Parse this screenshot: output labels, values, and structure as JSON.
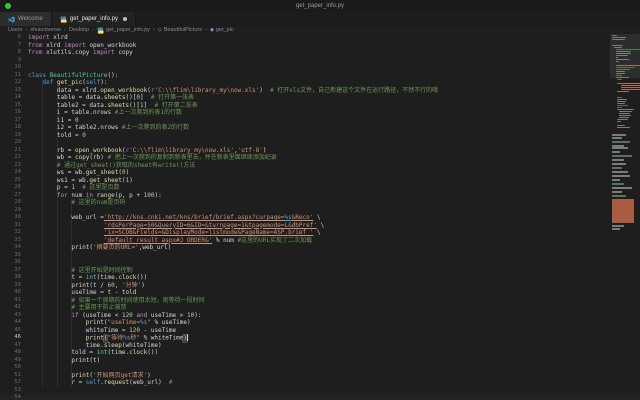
{
  "window": {
    "title": "get_paper_info.py"
  },
  "tabs": [
    {
      "label": "Welcome",
      "icon": "vscode-logo-icon",
      "active": false,
      "modified": false
    },
    {
      "label": "get_paper_info.py",
      "icon": "python-file-icon",
      "active": true,
      "modified": true
    }
  ],
  "breadcrumb": {
    "separator": "›",
    "segments": [
      {
        "label": "Users"
      },
      {
        "label": "shuiuniverse"
      },
      {
        "label": "Desktop"
      },
      {
        "label": "get_paper_info.py",
        "icon": "python-file-icon"
      },
      {
        "label": "BeautifulPicture",
        "icon": "class-symbol-icon"
      },
      {
        "label": "get_pic",
        "icon": "method-symbol-icon"
      }
    ]
  },
  "theme": {
    "traffic_light_green": "#2bc840",
    "syntax": {
      "kw": "#c586c0",
      "kb": "#569cd6",
      "cls": "#4ec9b0",
      "fn": "#dcdcaa",
      "str": "#ce9178",
      "com": "#6a9955",
      "num": "#b5cea8",
      "txt": "#d4d4d4"
    }
  },
  "editor": {
    "first_line": 6,
    "active_line": 46,
    "lines": [
      {
        "n": 6,
        "t": [
          [
            "kw",
            "import"
          ],
          [
            "txt",
            " xlrd"
          ]
        ]
      },
      {
        "n": 7,
        "t": [
          [
            "kw",
            "from"
          ],
          [
            "txt",
            " xlrd "
          ],
          [
            "kw",
            "import"
          ],
          [
            "txt",
            " open_workbook"
          ]
        ]
      },
      {
        "n": 8,
        "t": [
          [
            "kw",
            "from"
          ],
          [
            "txt",
            " xlutils.copy "
          ],
          [
            "kw",
            "import"
          ],
          [
            "txt",
            " copy"
          ]
        ]
      },
      {
        "n": 9,
        "t": []
      },
      {
        "n": 10,
        "t": []
      },
      {
        "n": 11,
        "t": [
          [
            "kb",
            "class"
          ],
          [
            "txt",
            " "
          ],
          [
            "cls",
            "BeautifulPicture"
          ],
          [
            "txt",
            "():"
          ]
        ]
      },
      {
        "n": 12,
        "t": [
          [
            "txt",
            "    "
          ],
          [
            "kb",
            "def"
          ],
          [
            "txt",
            " "
          ],
          [
            "fn",
            "get_pic"
          ],
          [
            "txt",
            "("
          ],
          [
            "kb",
            "self"
          ],
          [
            "txt",
            "):"
          ]
        ]
      },
      {
        "n": 13,
        "t": [
          [
            "txt",
            "        data = xlrd."
          ],
          [
            "fn",
            "open_workbook"
          ],
          [
            "txt",
            "("
          ],
          [
            "kb",
            "r"
          ],
          [
            "str",
            "'C:\\\\flim\\library_my\\now.xls'"
          ],
          [
            "txt",
            ")  "
          ],
          [
            "com",
            "# 打开xls文件，自己新建这个文件在运行路径，不然不行的哦"
          ]
        ]
      },
      {
        "n": 14,
        "t": [
          [
            "txt",
            "        table = data."
          ],
          [
            "fn",
            "sheets"
          ],
          [
            "txt",
            "()["
          ],
          [
            "num",
            "0"
          ],
          [
            "txt",
            "]  "
          ],
          [
            "com",
            "# 打开第一张表"
          ]
        ]
      },
      {
        "n": 15,
        "t": [
          [
            "txt",
            "        table2 = data."
          ],
          [
            "fn",
            "sheets"
          ],
          [
            "txt",
            "()["
          ],
          [
            "num",
            "1"
          ],
          [
            "txt",
            "]  "
          ],
          [
            "com",
            "# 打开第二张表"
          ]
        ]
      },
      {
        "n": 16,
        "t": [
          [
            "txt",
            "        i = table.nrows "
          ],
          [
            "com",
            "#上一次爬到的表1的行数"
          ]
        ]
      },
      {
        "n": 17,
        "t": [
          [
            "txt",
            "        i1 = "
          ],
          [
            "num",
            "0"
          ]
        ]
      },
      {
        "n": 18,
        "t": [
          [
            "txt",
            "        i2 = table2.nrows "
          ],
          [
            "com",
            "#上一次爬到的表2的行数"
          ]
        ]
      },
      {
        "n": 19,
        "t": [
          [
            "txt",
            "        told = "
          ],
          [
            "num",
            "0"
          ]
        ]
      },
      {
        "n": 20,
        "t": []
      },
      {
        "n": 21,
        "t": [
          [
            "txt",
            "        rb = "
          ],
          [
            "fn",
            "open_workbook"
          ],
          [
            "txt",
            "("
          ],
          [
            "kb",
            "r"
          ],
          [
            "str",
            "'C:\\\\flim\\library_my\\now.xls'"
          ],
          [
            "txt",
            ","
          ],
          [
            "str",
            "'utf-8'"
          ],
          [
            "txt",
            ")"
          ]
        ]
      },
      {
        "n": 22,
        "t": [
          [
            "txt",
            "        wb = "
          ],
          [
            "fn",
            "copy"
          ],
          [
            "txt",
            "(rb) "
          ],
          [
            "com",
            "# 把上一次爬到的复制到新表里去，并在新表里面继续添加纪录"
          ]
        ]
      },
      {
        "n": 23,
        "t": [
          [
            "txt",
            "        "
          ],
          [
            "com",
            "# 通过get_sheet()获取的sheet有write()方法"
          ]
        ]
      },
      {
        "n": 24,
        "t": [
          [
            "txt",
            "        ws = wb."
          ],
          [
            "fn",
            "get_sheet"
          ],
          [
            "txt",
            "("
          ],
          [
            "num",
            "0"
          ],
          [
            "txt",
            ")"
          ]
        ]
      },
      {
        "n": 25,
        "t": [
          [
            "txt",
            "        ws1 = wb."
          ],
          [
            "fn",
            "get_sheet"
          ],
          [
            "txt",
            "("
          ],
          [
            "num",
            "1"
          ],
          [
            "txt",
            ")"
          ]
        ]
      },
      {
        "n": 26,
        "t": [
          [
            "txt",
            "        p = "
          ],
          [
            "num",
            "1"
          ],
          [
            "txt",
            "  "
          ],
          [
            "com",
            "# 这里是页数"
          ]
        ]
      },
      {
        "n": 27,
        "t": [
          [
            "txt",
            "        "
          ],
          [
            "kw",
            "for"
          ],
          [
            "txt",
            " num "
          ],
          [
            "kw",
            "in"
          ],
          [
            "txt",
            " "
          ],
          [
            "fn",
            "range"
          ],
          [
            "txt",
            "(p, p + "
          ],
          [
            "num",
            "100"
          ],
          [
            "txt",
            "):"
          ]
        ]
      },
      {
        "n": 28,
        "t": [
          [
            "txt",
            "            "
          ],
          [
            "com",
            "# 这里的num是页码"
          ]
        ]
      },
      {
        "n": 29,
        "t": []
      },
      {
        "n": 30,
        "t": [
          [
            "txt",
            "            web_url ="
          ],
          [
            "url",
            "'http://kns.cnki.net/kns/brief/brief.aspx?curpage="
          ],
          [
            "fmtu",
            "%s"
          ],
          [
            "url",
            "&Reco'"
          ],
          [
            "txt",
            " \\"
          ]
        ]
      },
      {
        "n": 31,
        "t": [
          [
            "txt",
            "                     "
          ],
          [
            "url",
            "'rdsPerPage=50&QueryID=6&ID=&turnpage=1&tpagemode=L&dbPref'"
          ],
          [
            "txt",
            " \\"
          ]
        ]
      },
      {
        "n": 32,
        "t": [
          [
            "txt",
            "                     "
          ],
          [
            "url",
            "'ix=SCDB&Fields=&DisplayMode=listmode&PageName=ASP.brief_'"
          ],
          [
            "txt",
            " \\"
          ]
        ]
      },
      {
        "n": 33,
        "t": [
          [
            "txt",
            "                     "
          ],
          [
            "url",
            "'default_result_aspx#J_ORDER&'"
          ],
          [
            "txt",
            " % num "
          ],
          [
            "com",
            "#这里的URL实现了二次加载"
          ]
        ]
      },
      {
        "n": 34,
        "t": [
          [
            "txt",
            "            "
          ],
          [
            "fn",
            "print"
          ],
          [
            "txt",
            "("
          ],
          [
            "str",
            "'摘要页的URL='"
          ],
          [
            "txt",
            ",web_url)"
          ]
        ]
      },
      {
        "n": 35,
        "t": []
      },
      {
        "n": 36,
        "t": []
      },
      {
        "n": 37,
        "t": [
          [
            "txt",
            "            "
          ],
          [
            "com",
            "# 这里开始是时间控制"
          ]
        ]
      },
      {
        "n": 38,
        "t": [
          [
            "txt",
            "            t = "
          ],
          [
            "cls",
            "int"
          ],
          [
            "txt",
            "(time."
          ],
          [
            "fn",
            "clock"
          ],
          [
            "txt",
            "())"
          ]
        ]
      },
      {
        "n": 39,
        "t": [
          [
            "txt",
            "            "
          ],
          [
            "fn",
            "print"
          ],
          [
            "txt",
            "(t / "
          ],
          [
            "num",
            "60"
          ],
          [
            "txt",
            ", "
          ],
          [
            "str",
            "'分钟'"
          ],
          [
            "txt",
            ")"
          ]
        ]
      },
      {
        "n": 40,
        "t": [
          [
            "txt",
            "            useTime = t - told"
          ]
        ]
      },
      {
        "n": 41,
        "t": [
          [
            "txt",
            "            "
          ],
          [
            "com",
            "# 如果一个周期的时间使用太短，则等待一段时间"
          ]
        ]
      },
      {
        "n": 42,
        "t": [
          [
            "txt",
            "            "
          ],
          [
            "com",
            "# 主要用于防止被禁"
          ]
        ]
      },
      {
        "n": 43,
        "t": [
          [
            "txt",
            "            "
          ],
          [
            "kw",
            "if"
          ],
          [
            "txt",
            " (useTime < "
          ],
          [
            "num",
            "120"
          ],
          [
            "txt",
            " "
          ],
          [
            "kw",
            "and"
          ],
          [
            "txt",
            " useTime > "
          ],
          [
            "num",
            "10"
          ],
          [
            "txt",
            "):"
          ]
        ]
      },
      {
        "n": 44,
        "t": [
          [
            "txt",
            "                "
          ],
          [
            "fn",
            "print"
          ],
          [
            "txt",
            "("
          ],
          [
            "str",
            "\"useTime="
          ],
          [
            "fmt",
            "%s"
          ],
          [
            "str",
            "\""
          ],
          [
            "txt",
            " % useTime)"
          ]
        ]
      },
      {
        "n": 45,
        "t": [
          [
            "txt",
            "                whiteTime = "
          ],
          [
            "num",
            "120"
          ],
          [
            "txt",
            " - useTime"
          ]
        ]
      },
      {
        "n": 46,
        "t": [
          [
            "txt",
            "                "
          ],
          [
            "fn",
            "print"
          ],
          [
            "brk",
            "("
          ],
          [
            "str",
            "\"等待"
          ],
          [
            "fmt",
            "%s"
          ],
          [
            "str",
            "秒\""
          ],
          [
            "txt",
            " % whiteTime"
          ],
          [
            "brk",
            ")"
          ],
          [
            "cursor",
            ""
          ]
        ]
      },
      {
        "n": 47,
        "t": [
          [
            "txt",
            "                time."
          ],
          [
            "fn",
            "sleep"
          ],
          [
            "txt",
            "(whiteTime)"
          ]
        ]
      },
      {
        "n": 48,
        "t": [
          [
            "txt",
            "            told = "
          ],
          [
            "cls",
            "int"
          ],
          [
            "txt",
            "(time."
          ],
          [
            "fn",
            "clock"
          ],
          [
            "txt",
            "())"
          ]
        ]
      },
      {
        "n": 49,
        "t": [
          [
            "txt",
            "            "
          ],
          [
            "fn",
            "print"
          ],
          [
            "txt",
            "(t)"
          ]
        ]
      },
      {
        "n": 50,
        "t": []
      },
      {
        "n": 51,
        "t": [
          [
            "txt",
            "            "
          ],
          [
            "fn",
            "print"
          ],
          [
            "txt",
            "("
          ],
          [
            "str",
            "'开始网页get请求'"
          ],
          [
            "txt",
            ")"
          ]
        ]
      },
      {
        "n": 52,
        "t": [
          [
            "txt",
            "            r = "
          ],
          [
            "kb",
            "self"
          ],
          [
            "txt",
            "."
          ],
          [
            "fn",
            "request"
          ],
          [
            "txt",
            "(web_url)  "
          ],
          [
            "com",
            "#"
          ]
        ]
      },
      {
        "n": 53,
        "t": []
      },
      {
        "n": 54,
        "t": []
      }
    ]
  },
  "minimap": {
    "mark_colors": {
      "com": "#527a52",
      "str": "#a5705a",
      "default": "#7c7c7c"
    },
    "extra_blocks": [
      [
        100,
        1.5,
        14,
        "#7c7c7c"
      ],
      [
        103,
        1.5,
        10,
        "#7c7c7c"
      ],
      [
        107,
        1.5,
        18,
        "#527a52"
      ],
      [
        111,
        1.5,
        12,
        "#7c7c7c"
      ],
      [
        113,
        1.5,
        16,
        "#7c7c7c"
      ],
      [
        117,
        1.5,
        8,
        "#7c7c7c"
      ],
      [
        121,
        1.5,
        20,
        "#527a52"
      ],
      [
        125,
        1.5,
        12,
        "#7c7c7c"
      ],
      [
        129,
        1.5,
        14,
        "#7c7c7c"
      ],
      [
        133,
        1.5,
        10,
        "#527a52"
      ],
      [
        137,
        1.5,
        16,
        "#7c7c7c"
      ],
      [
        141,
        1.5,
        18,
        "#7c7c7c"
      ],
      [
        145,
        1.5,
        8,
        "#7c7c7c"
      ],
      [
        149,
        1.5,
        12,
        "#527a52"
      ],
      [
        153,
        1.5,
        20,
        "#7c7c7c"
      ],
      [
        157,
        1.5,
        10,
        "#7c7c7c"
      ],
      [
        161,
        1.5,
        14,
        "#527a52"
      ],
      [
        165,
        24,
        22,
        "#a85d42"
      ],
      [
        191,
        1.5,
        12,
        "#7c7c7c"
      ],
      [
        194,
        1.5,
        8,
        "#7c7c7c"
      ]
    ]
  }
}
